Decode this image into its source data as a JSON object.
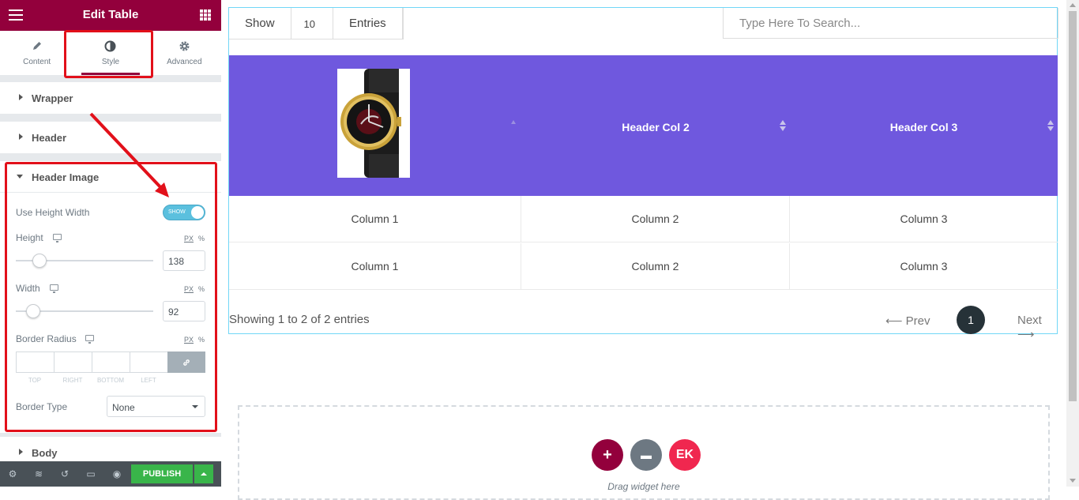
{
  "panel": {
    "title": "Edit Table",
    "tabs": [
      {
        "label": "Content",
        "icon": "pencil-icon"
      },
      {
        "label": "Style",
        "icon": "contrast-icon"
      },
      {
        "label": "Advanced",
        "icon": "gear-icon"
      }
    ],
    "active_tab": "Style",
    "sections": {
      "wrapper": "Wrapper",
      "header": "Header",
      "header_image": "Header Image",
      "body": "Body"
    },
    "controls": {
      "use_height_width": {
        "label": "Use Height Width",
        "toggle_text": "SHOW",
        "on": true
      },
      "height": {
        "label": "Height",
        "value": "138",
        "unit_px": "PX",
        "unit_pct": "%",
        "slider_fraction": 0.14
      },
      "width": {
        "label": "Width",
        "value": "92",
        "unit_px": "PX",
        "unit_pct": "%",
        "slider_fraction": 0.09
      },
      "border_radius": {
        "label": "Border Radius",
        "unit_px": "PX",
        "unit_pct": "%",
        "sides": [
          "TOP",
          "RIGHT",
          "BOTTOM",
          "LEFT"
        ]
      },
      "border_type": {
        "label": "Border Type",
        "value": "None"
      }
    },
    "footer": {
      "publish": "PUBLISH"
    }
  },
  "table": {
    "show_label": "Show",
    "entries_count": "10",
    "entries_label": "Entries",
    "search_placeholder": "Type Here To Search...",
    "headers": [
      "Header Col 2",
      "Header Col 3"
    ],
    "rows": [
      [
        "Column 1",
        "Column 2",
        "Column 3"
      ],
      [
        "Column 1",
        "Column 2",
        "Column 3"
      ]
    ],
    "showing": "Showing 1 to 2 of 2 entries",
    "prev": "Prev",
    "page": "1",
    "next": "Next",
    "header_color": "#6f58de"
  },
  "dropzone": {
    "text": "Drag widget here"
  },
  "colors": {
    "brand": "#93003c",
    "publish": "#39b54a",
    "highlight": "#e2101a"
  }
}
